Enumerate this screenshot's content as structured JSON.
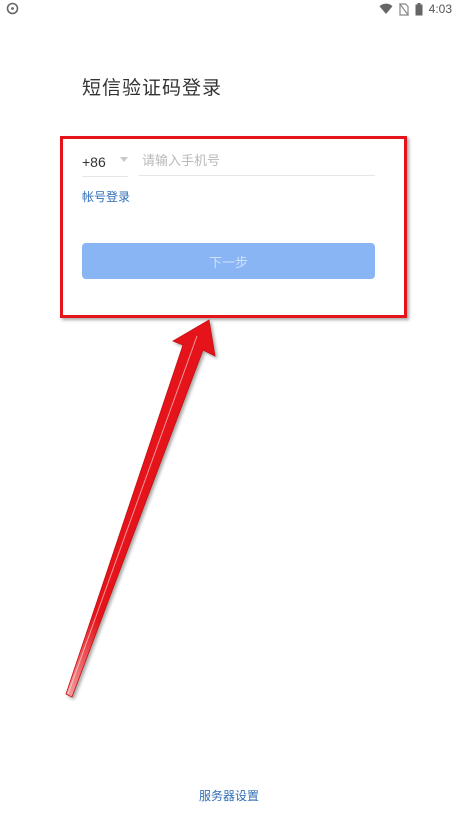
{
  "status_bar": {
    "time": "4:03",
    "icons": [
      "app-notification-icon",
      "wifi-icon",
      "no-sim-icon",
      "battery-icon"
    ]
  },
  "login": {
    "title": "短信验证码登录",
    "country_code": "+86",
    "phone_placeholder": "请输入手机号",
    "phone_value": "",
    "account_login_link": "帐号登录",
    "next_button": "下一步"
  },
  "footer": {
    "server_settings_link": "服务器设置"
  },
  "colors": {
    "link": "#2f6db5",
    "button_disabled_bg": "#8ab5f5",
    "button_disabled_text": "#cfe0fb",
    "annotation_red": "#e5141b",
    "title_text": "#333333"
  }
}
